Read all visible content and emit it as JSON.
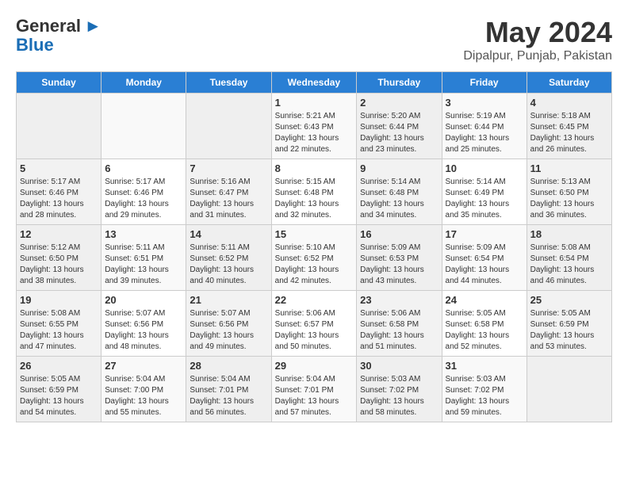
{
  "header": {
    "logo_general": "General",
    "logo_blue": "Blue",
    "title": "May 2024",
    "subtitle": "Dipalpur, Punjab, Pakistan"
  },
  "calendar": {
    "days_of_week": [
      "Sunday",
      "Monday",
      "Tuesday",
      "Wednesday",
      "Thursday",
      "Friday",
      "Saturday"
    ],
    "weeks": [
      {
        "days": [
          {
            "num": "",
            "info": ""
          },
          {
            "num": "",
            "info": ""
          },
          {
            "num": "",
            "info": ""
          },
          {
            "num": "1",
            "info": "Sunrise: 5:21 AM\nSunset: 6:43 PM\nDaylight: 13 hours and 22 minutes."
          },
          {
            "num": "2",
            "info": "Sunrise: 5:20 AM\nSunset: 6:44 PM\nDaylight: 13 hours and 23 minutes."
          },
          {
            "num": "3",
            "info": "Sunrise: 5:19 AM\nSunset: 6:44 PM\nDaylight: 13 hours and 25 minutes."
          },
          {
            "num": "4",
            "info": "Sunrise: 5:18 AM\nSunset: 6:45 PM\nDaylight: 13 hours and 26 minutes."
          }
        ]
      },
      {
        "days": [
          {
            "num": "5",
            "info": "Sunrise: 5:17 AM\nSunset: 6:46 PM\nDaylight: 13 hours and 28 minutes."
          },
          {
            "num": "6",
            "info": "Sunrise: 5:17 AM\nSunset: 6:46 PM\nDaylight: 13 hours and 29 minutes."
          },
          {
            "num": "7",
            "info": "Sunrise: 5:16 AM\nSunset: 6:47 PM\nDaylight: 13 hours and 31 minutes."
          },
          {
            "num": "8",
            "info": "Sunrise: 5:15 AM\nSunset: 6:48 PM\nDaylight: 13 hours and 32 minutes."
          },
          {
            "num": "9",
            "info": "Sunrise: 5:14 AM\nSunset: 6:48 PM\nDaylight: 13 hours and 34 minutes."
          },
          {
            "num": "10",
            "info": "Sunrise: 5:14 AM\nSunset: 6:49 PM\nDaylight: 13 hours and 35 minutes."
          },
          {
            "num": "11",
            "info": "Sunrise: 5:13 AM\nSunset: 6:50 PM\nDaylight: 13 hours and 36 minutes."
          }
        ]
      },
      {
        "days": [
          {
            "num": "12",
            "info": "Sunrise: 5:12 AM\nSunset: 6:50 PM\nDaylight: 13 hours and 38 minutes."
          },
          {
            "num": "13",
            "info": "Sunrise: 5:11 AM\nSunset: 6:51 PM\nDaylight: 13 hours and 39 minutes."
          },
          {
            "num": "14",
            "info": "Sunrise: 5:11 AM\nSunset: 6:52 PM\nDaylight: 13 hours and 40 minutes."
          },
          {
            "num": "15",
            "info": "Sunrise: 5:10 AM\nSunset: 6:52 PM\nDaylight: 13 hours and 42 minutes."
          },
          {
            "num": "16",
            "info": "Sunrise: 5:09 AM\nSunset: 6:53 PM\nDaylight: 13 hours and 43 minutes."
          },
          {
            "num": "17",
            "info": "Sunrise: 5:09 AM\nSunset: 6:54 PM\nDaylight: 13 hours and 44 minutes."
          },
          {
            "num": "18",
            "info": "Sunrise: 5:08 AM\nSunset: 6:54 PM\nDaylight: 13 hours and 46 minutes."
          }
        ]
      },
      {
        "days": [
          {
            "num": "19",
            "info": "Sunrise: 5:08 AM\nSunset: 6:55 PM\nDaylight: 13 hours and 47 minutes."
          },
          {
            "num": "20",
            "info": "Sunrise: 5:07 AM\nSunset: 6:56 PM\nDaylight: 13 hours and 48 minutes."
          },
          {
            "num": "21",
            "info": "Sunrise: 5:07 AM\nSunset: 6:56 PM\nDaylight: 13 hours and 49 minutes."
          },
          {
            "num": "22",
            "info": "Sunrise: 5:06 AM\nSunset: 6:57 PM\nDaylight: 13 hours and 50 minutes."
          },
          {
            "num": "23",
            "info": "Sunrise: 5:06 AM\nSunset: 6:58 PM\nDaylight: 13 hours and 51 minutes."
          },
          {
            "num": "24",
            "info": "Sunrise: 5:05 AM\nSunset: 6:58 PM\nDaylight: 13 hours and 52 minutes."
          },
          {
            "num": "25",
            "info": "Sunrise: 5:05 AM\nSunset: 6:59 PM\nDaylight: 13 hours and 53 minutes."
          }
        ]
      },
      {
        "days": [
          {
            "num": "26",
            "info": "Sunrise: 5:05 AM\nSunset: 6:59 PM\nDaylight: 13 hours and 54 minutes."
          },
          {
            "num": "27",
            "info": "Sunrise: 5:04 AM\nSunset: 7:00 PM\nDaylight: 13 hours and 55 minutes."
          },
          {
            "num": "28",
            "info": "Sunrise: 5:04 AM\nSunset: 7:01 PM\nDaylight: 13 hours and 56 minutes."
          },
          {
            "num": "29",
            "info": "Sunrise: 5:04 AM\nSunset: 7:01 PM\nDaylight: 13 hours and 57 minutes."
          },
          {
            "num": "30",
            "info": "Sunrise: 5:03 AM\nSunset: 7:02 PM\nDaylight: 13 hours and 58 minutes."
          },
          {
            "num": "31",
            "info": "Sunrise: 5:03 AM\nSunset: 7:02 PM\nDaylight: 13 hours and 59 minutes."
          },
          {
            "num": "",
            "info": ""
          }
        ]
      }
    ]
  }
}
